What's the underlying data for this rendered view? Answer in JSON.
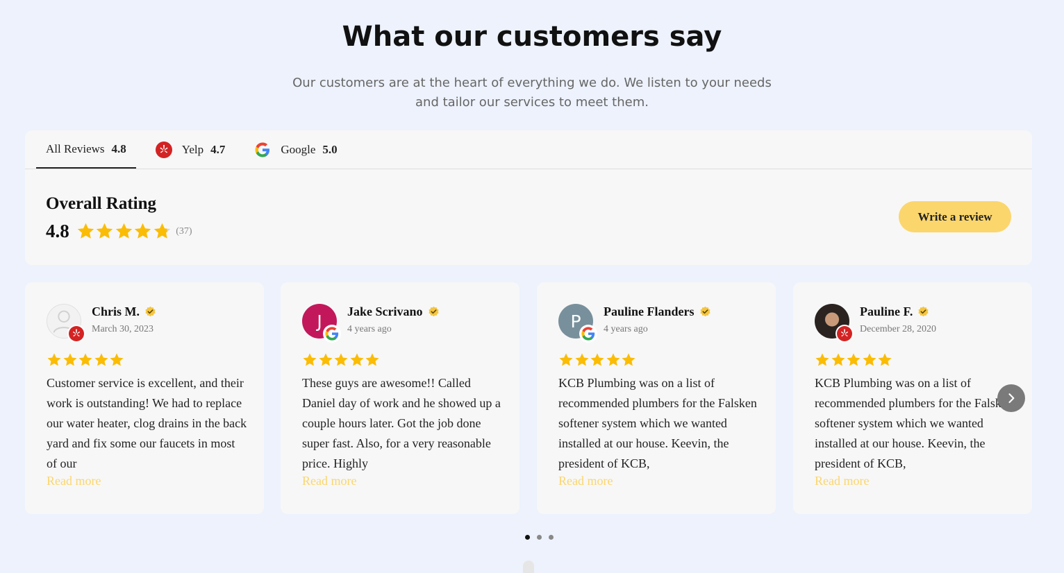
{
  "header": {
    "title": "What our customers say",
    "subtitle": "Our customers are at the heart of everything we do. We listen to your needs and tailor our services to meet them."
  },
  "tabs": [
    {
      "label": "All Reviews",
      "score": "4.8",
      "active": true,
      "icon": "none"
    },
    {
      "label": "Yelp",
      "score": "4.7",
      "active": false,
      "icon": "yelp-icon"
    },
    {
      "label": "Google",
      "score": "5.0",
      "active": false,
      "icon": "google-icon"
    }
  ],
  "overall": {
    "title": "Overall Rating",
    "rating": "4.8",
    "count": "(37)",
    "stars": 4.8
  },
  "write_review_label": "Write a review",
  "reviews": [
    {
      "name": "Chris M.",
      "date": "March 30, 2023",
      "source": "yelp",
      "avatar": "default-avatar",
      "stars": 5,
      "text": "Customer service is excellent, and their work is outstanding! We had to replace our water heater, clog drains in the back yard and fix some our faucets in most of our",
      "read_more": "Read more"
    },
    {
      "name": "Jake Scrivano",
      "date": "4 years ago",
      "source": "google",
      "avatar": "J",
      "avatar_color": "#c2185b",
      "stars": 5,
      "text": "These guys are awesome!! Called Daniel day of work and he showed up a couple hours later. Got the job done super fast. Also, for a very reasonable price. Highly",
      "read_more": "Read more"
    },
    {
      "name": "Pauline Flanders",
      "date": "4 years ago",
      "source": "google",
      "avatar": "P",
      "avatar_color": "#78909c",
      "stars": 5,
      "text": "KCB Plumbing was on a list of recommended plumbers for the Falsken softener system which we wanted installed at our house. Keevin, the president of KCB,",
      "read_more": "Read more"
    },
    {
      "name": "Pauline F.",
      "date": "December 28, 2020",
      "source": "yelp",
      "avatar": "photo",
      "stars": 5,
      "text": "KCB Plumbing was on a list of recommended plumbers for the Falsken softener system which we wanted installed at our house. Keevin, the president of KCB,",
      "read_more": "Read more"
    }
  ],
  "colors": {
    "background": "#edf2fc",
    "panel": "#f7f7f7",
    "star": "#fbbc05",
    "accent_button": "#fbd66d",
    "read_more": "#fbd66d",
    "yelp_red": "#d32323"
  },
  "pagination": {
    "pages": 3,
    "active": 0
  }
}
